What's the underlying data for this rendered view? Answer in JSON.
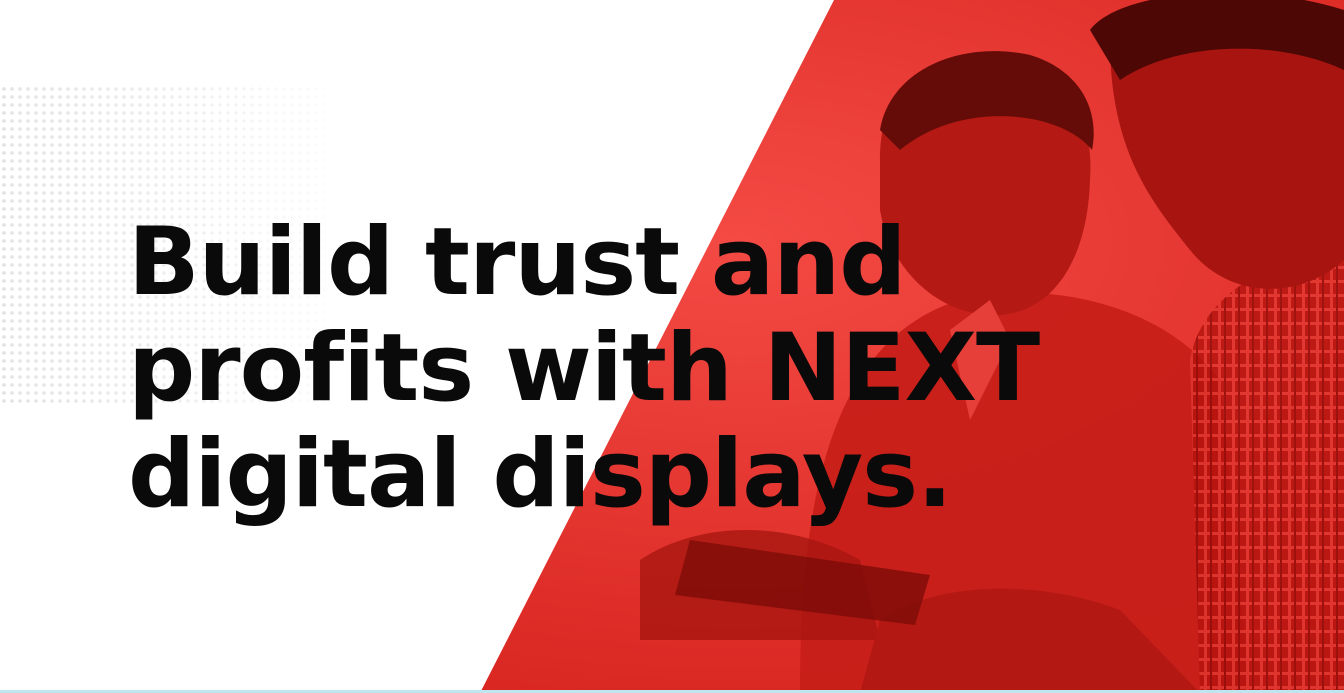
{
  "banner": {
    "headline_lines": [
      "Build trust and",
      "profits with NEXT",
      "digital displays."
    ]
  },
  "colors": {
    "accent_red": "#f0322e",
    "text": "#0a0a0a",
    "background": "#ffffff"
  }
}
